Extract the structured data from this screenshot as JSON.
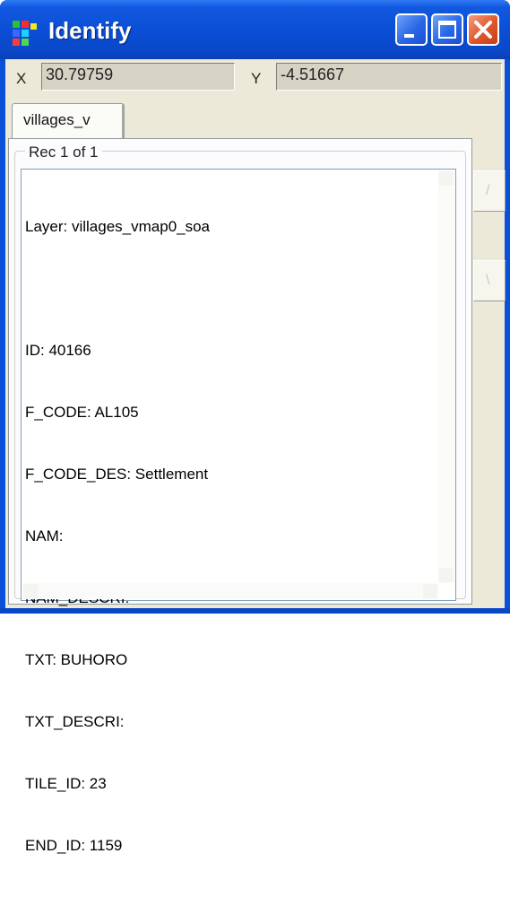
{
  "window": {
    "title": "Identify"
  },
  "coords": {
    "x_label": "X",
    "x_value": "30.79759",
    "y_label": "Y",
    "y_value": "-4.51667"
  },
  "tabs": [
    {
      "label": "villages_v"
    }
  ],
  "record": {
    "group_label": "Rec 1 of 1",
    "lines": [
      "Layer: villages_vmap0_soa",
      "",
      "ID: 40166",
      "F_CODE: AL105",
      "F_CODE_DES: Settlement",
      "NAM:",
      "NAM_DESCRI:",
      "TXT: BUHORO",
      "TXT_DESCRI:",
      "TILE_ID: 23",
      "END_ID: 1159"
    ]
  },
  "side_buttons": [
    {
      "label": "/"
    },
    {
      "label": "\\"
    }
  ],
  "colors": {
    "titlebar": "#0a4fd6",
    "client": "#ece9d8",
    "close": "#e0562c"
  },
  "icons": {
    "app": "identify-app-icon",
    "minimize": "minimize-icon",
    "maximize": "maximize-icon",
    "close": "close-icon"
  }
}
